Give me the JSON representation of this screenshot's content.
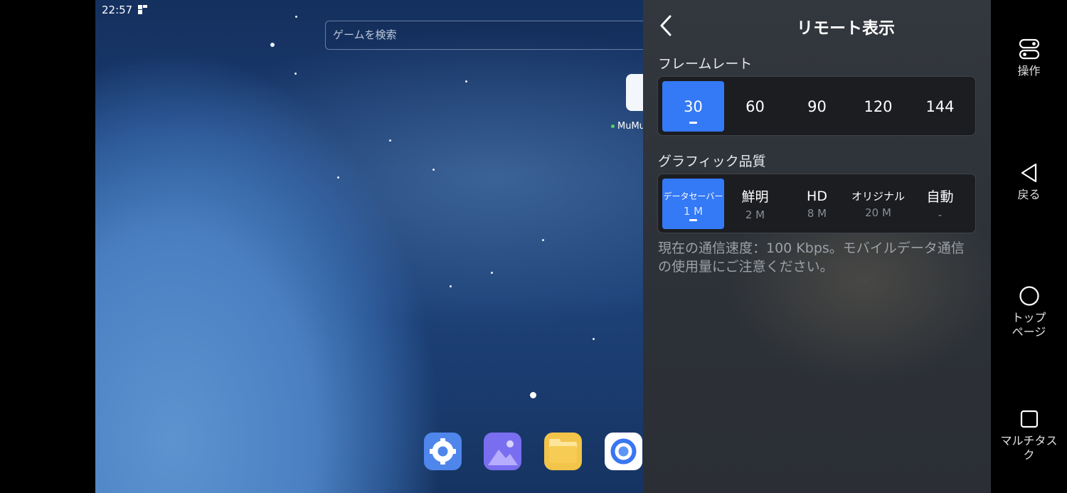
{
  "status_bar": {
    "time": "22:57"
  },
  "launcher": {
    "search_placeholder": "ゲームを検索",
    "app_label_partial": "MuMu",
    "dock": [
      "settings-app",
      "gallery-app",
      "files-app",
      "browser-app"
    ]
  },
  "panel": {
    "title": "リモート表示",
    "frame_rate": {
      "label": "フレームレート",
      "options": [
        "30",
        "60",
        "90",
        "120",
        "144"
      ],
      "selected": "30"
    },
    "graphics": {
      "label": "グラフィック品質",
      "options": [
        {
          "name": "データセーバー",
          "size": "1 M"
        },
        {
          "name": "鮮明",
          "size": "2 M"
        },
        {
          "name": "HD",
          "size": "8 M"
        },
        {
          "name": "オリジナル",
          "size": "20 M"
        },
        {
          "name": "自動",
          "size": "-"
        }
      ],
      "selected": "データセーバー"
    },
    "notice": "現在の通信速度：100 Kbps。モバイルデータ通信の使用量にご注意ください。"
  },
  "nav_rail": {
    "operate": "操作",
    "back": "戻る",
    "home": "トップページ",
    "multitask": "マルチタスク"
  },
  "colors": {
    "accent": "#3479f6",
    "panel_bg": "#2f3339"
  }
}
